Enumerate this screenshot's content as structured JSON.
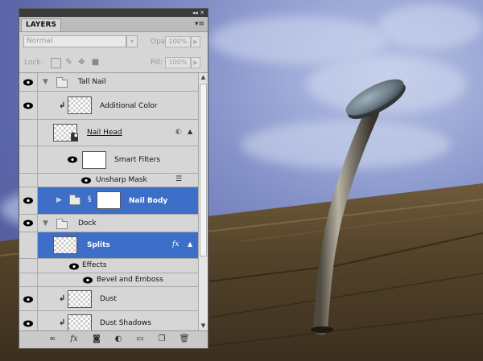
{
  "panel": {
    "title_tab": "LAYERS",
    "title_controls": "◂◂ ✕",
    "menu_icon": "panel-menu-icon"
  },
  "options": {
    "blend_mode": "Normal",
    "opacity_label": "Opacity:",
    "opacity_value": "100%",
    "lock_label": "Lock:",
    "fill_label": "Fill:",
    "fill_value": "100%"
  },
  "layers": [
    {
      "type": "group",
      "name": "Tall Nail",
      "visible": true,
      "expanded": true
    },
    {
      "type": "layer",
      "name": "Additional Color",
      "visible": true,
      "clipped": true
    },
    {
      "type": "smart-object",
      "name": "Nail Head",
      "visible": false
    },
    {
      "type": "sub",
      "name": "Smart Filters",
      "visible": true
    },
    {
      "type": "filter",
      "name": "Unsharp Mask",
      "visible": true
    },
    {
      "type": "layer",
      "name": "Nail Body",
      "visible": true,
      "selected": true,
      "linked_mask": true
    },
    {
      "type": "group",
      "name": "Dock",
      "visible": true,
      "expanded": true
    },
    {
      "type": "layer",
      "name": "Splits",
      "visible": false,
      "selected": true,
      "fx": "fx"
    },
    {
      "type": "effects",
      "name": "Effects",
      "visible": true
    },
    {
      "type": "effect",
      "name": "Bevel and Emboss",
      "visible": true
    },
    {
      "type": "layer",
      "name": "Dust",
      "visible": true,
      "clipped": true
    },
    {
      "type": "layer",
      "name": "Dust Shadows",
      "visible": true,
      "clipped": true
    }
  ],
  "footer_icons": [
    "link-layers-icon",
    "fx-icon",
    "add-mask-icon",
    "adjustment-layer-icon",
    "new-group-icon",
    "new-layer-icon",
    "trash-icon"
  ],
  "colors": {
    "selected_row": "#3d6ec8",
    "panel_bg": "#d6d6d6"
  }
}
